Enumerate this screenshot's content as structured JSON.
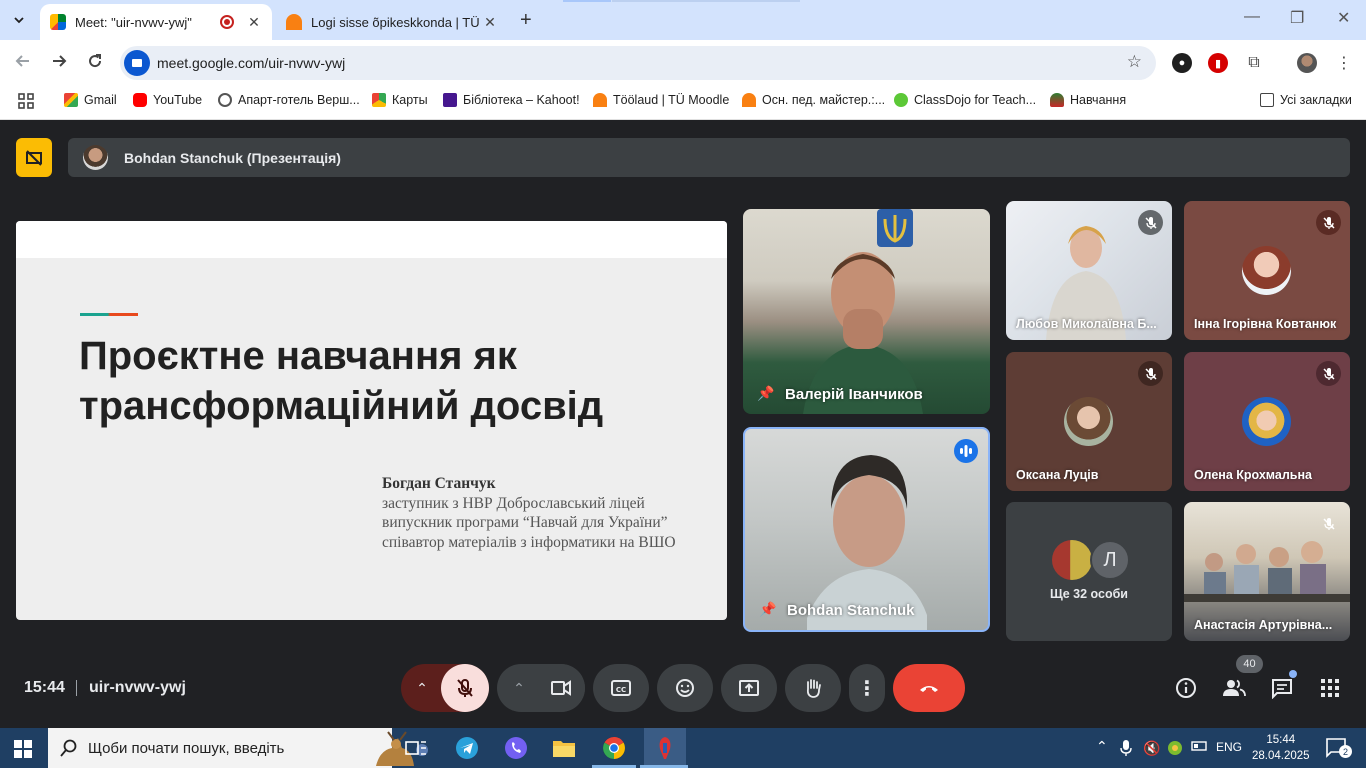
{
  "browser": {
    "tabs": [
      {
        "title": "Meet: \"uir-nvwv-ywj\"",
        "active": true
      },
      {
        "title": "Logi sisse õpikeskkonda | TÜ M",
        "active": false
      }
    ],
    "url": "meet.google.com/uir-nvwv-ywj",
    "bookmarks": [
      {
        "label": "Gmail",
        "icon": "gmail-icon"
      },
      {
        "label": "YouTube",
        "icon": "youtube-icon"
      },
      {
        "label": "Апарт-готель Верш...",
        "icon": "globe-icon"
      },
      {
        "label": "Карты",
        "icon": "maps-icon"
      },
      {
        "label": "Бібліотека – Kahoot!",
        "icon": "kahoot-icon"
      },
      {
        "label": "Töölaud | TÜ Moodle",
        "icon": "moodle-icon"
      },
      {
        "label": "Осн. пед. майстер.:...",
        "icon": "moodle-icon"
      },
      {
        "label": "ClassDojo for Teach...",
        "icon": "classdojo-icon"
      },
      {
        "label": "Навчання",
        "icon": "plant-icon"
      }
    ],
    "all_bookmarks": "Усі закладки"
  },
  "meet": {
    "presenter_bar": "Bohdan Stanchuk (Презентація)",
    "slide": {
      "title": "Проєктне навчання як трансформаційний досвід",
      "author_name": "Богдан Станчук",
      "author_lines": [
        "заступник з НВР Доброславський ліцей",
        "випускник програми “Навчай для України”",
        "співавтор матеріалів з інформатики на ВШО"
      ]
    },
    "participants": [
      {
        "name": "Валерій Іванчиков",
        "pinned": true
      },
      {
        "name": "Bohdan Stanchuk",
        "pinned": true,
        "speaking": true
      },
      {
        "name": "Любов Миколаївна Б...",
        "muted": true
      },
      {
        "name": "Інна Ігорівна Ковтанюк",
        "muted": true
      },
      {
        "name": "Оксана Луців",
        "muted": true
      },
      {
        "name": "Олена Крохмальна",
        "muted": true
      },
      {
        "name": "Анастасія Артурівна...",
        "muted": true
      }
    ],
    "more_people": "Ще 32 особи",
    "more_avatar_letter": "Л",
    "time": "15:44",
    "meeting_code": "uir-nvwv-ywj",
    "participant_count": "40"
  },
  "taskbar": {
    "search_placeholder": "Щоби почати пошук, введіть",
    "language": "ENG",
    "time": "15:44",
    "date": "28.04.2025",
    "notifications": "2"
  },
  "colors": {
    "meet_bg": "#202124",
    "control_bg": "#3c4043",
    "end_call": "#ea4335",
    "mic_off_bg": "#f9dedc",
    "presentation_badge": "#fbbc04"
  }
}
